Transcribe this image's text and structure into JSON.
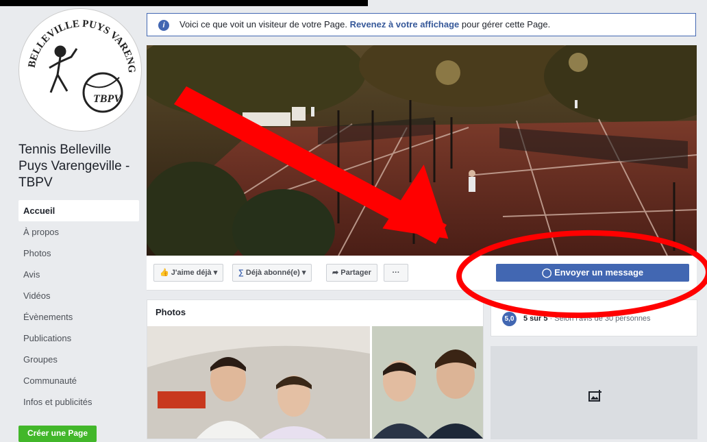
{
  "sidebar": {
    "logo_text_top": "BELLEVILLE PUYS VARENGEVILLE",
    "logo_text_badge": "TBPV",
    "page_name": "Tennis Belleville Puys Varengeville - TBPV",
    "nav": [
      {
        "label": "Accueil",
        "active": true
      },
      {
        "label": "À propos"
      },
      {
        "label": "Photos"
      },
      {
        "label": "Avis"
      },
      {
        "label": "Vidéos"
      },
      {
        "label": "Évènements"
      },
      {
        "label": "Publications"
      },
      {
        "label": "Groupes"
      },
      {
        "label": "Communauté"
      },
      {
        "label": "Infos et publicités"
      }
    ],
    "create_page": "Créer une Page"
  },
  "notice": {
    "text_before": "Voici ce que voit un visiteur de votre Page. ",
    "link": "Revenez à votre affichage",
    "text_after": " pour gérer cette Page."
  },
  "actions": {
    "like": "J'aime déjà",
    "follow": "Déjà abonné(e)",
    "share": "Partager",
    "more": "···",
    "message": "Envoyer un message"
  },
  "photos": {
    "title": "Photos"
  },
  "reviews": {
    "score": "5,0",
    "rating": "5 sur 5",
    "detail": " · Selon l'avis de 30 personnes"
  },
  "colors": {
    "brand": "#4267b2",
    "annotation": "#ff0000",
    "green": "#42b72a"
  },
  "icons": [
    "info-icon",
    "like-icon",
    "rss-icon",
    "share-icon",
    "messenger-icon",
    "add-photo-icon"
  ]
}
